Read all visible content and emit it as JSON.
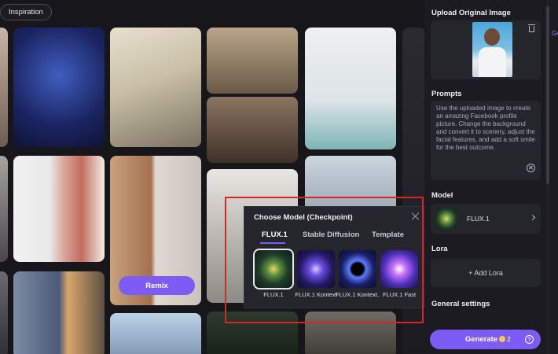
{
  "gallery": {
    "inspiration_tab": "Inspiration",
    "remix_label": "Remix",
    "cards": [
      "person-left-1",
      "alien-bunny",
      "consulat-street",
      "girl-street",
      "asian-man-restore",
      "woman-portrait",
      "anime-couple",
      "vintage-soldiers",
      "vintage-couple",
      "blond-man",
      "dark-card",
      "bald-man-glasses",
      "sky-landscape",
      "last-card"
    ]
  },
  "model_dialog": {
    "title": "Choose Model (Checkpoint)",
    "tabs": [
      "FLUX.1",
      "Stable Diffusion",
      "Template"
    ],
    "active_tab": "FLUX.1",
    "models": [
      {
        "label": "FLUX.1",
        "selected": true
      },
      {
        "label": "FLUX.1 Kontext",
        "selected": false
      },
      {
        "label": "FLUX.1 Kontext...",
        "selected": false
      },
      {
        "label": "FLUX.1 Fast",
        "selected": false
      }
    ],
    "highlight_color": "#d62626"
  },
  "panel": {
    "upload_title": "Upload Original Image",
    "prompts_title": "Prompts",
    "prompt_text": "Use the uploaded image to create an amazing Facebook profile picture. Change the background and convert it to scenery, adjust the facial features, and add a soft smile for the best outcome.",
    "model_title": "Model",
    "model_name": "FLUX.1",
    "lora_title": "Lora",
    "add_lora_label": "+ Add Lora",
    "general_settings_title": "General settings",
    "generate_label": "Generate",
    "generate_cost": "2",
    "edge_text": "Ge"
  },
  "colors": {
    "accent": "#7d5cf5",
    "background": "#141418",
    "panel": "#1b1b21"
  }
}
